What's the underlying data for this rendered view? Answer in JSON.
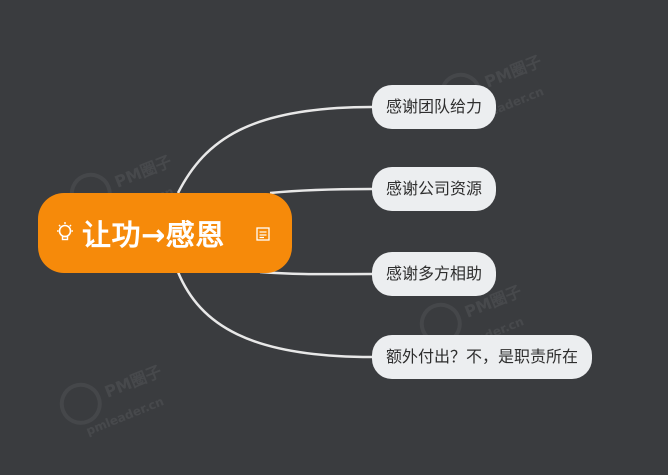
{
  "root": {
    "label": "让功→感恩",
    "icon": "bulb-icon",
    "note_icon": "note-icon"
  },
  "children": [
    {
      "label": "感谢团队给力"
    },
    {
      "label": "感谢公司资源"
    },
    {
      "label": "感谢多方相助"
    },
    {
      "label": "额外付出？不，是职责所在"
    }
  ],
  "watermark": {
    "brand": "PM圈子",
    "site": "pmleader.cn"
  },
  "colors": {
    "background": "#3a3c3f",
    "root": "#f68a0a",
    "child": "#eceef0",
    "link": "#e8e8e8"
  }
}
